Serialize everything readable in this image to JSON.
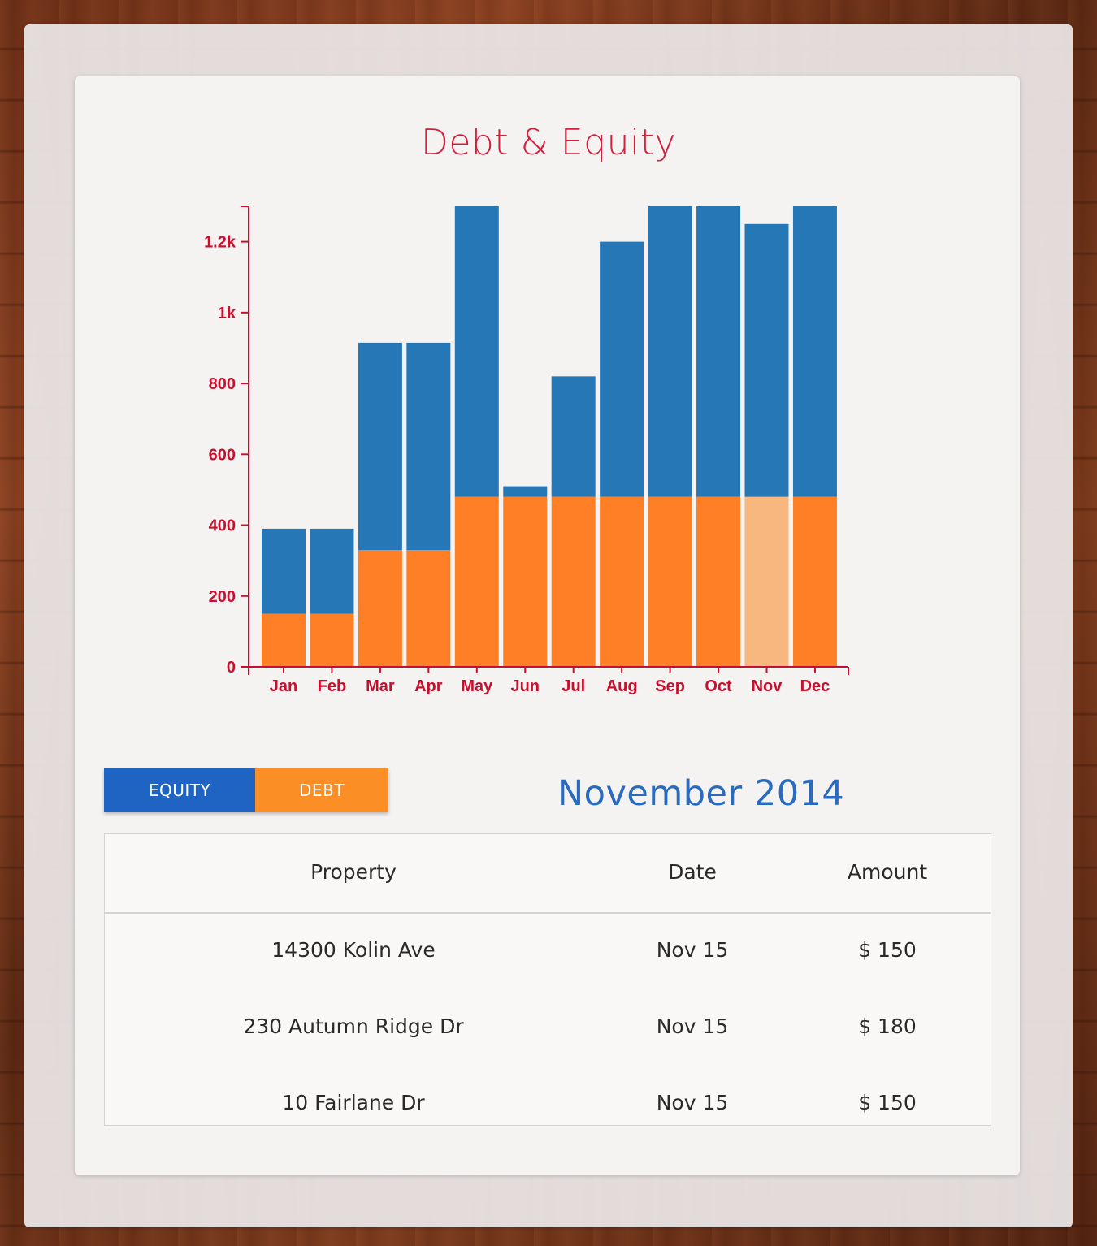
{
  "chart_data": {
    "type": "bar",
    "stacked": true,
    "title": "Debt & Equity",
    "categories": [
      "Jan",
      "Feb",
      "Mar",
      "Apr",
      "May",
      "Jun",
      "Jul",
      "Aug",
      "Sep",
      "Oct",
      "Nov",
      "Dec"
    ],
    "series": [
      {
        "name": "Debt",
        "color": "#ff7f27",
        "values": [
          150,
          150,
          330,
          330,
          480,
          480,
          480,
          480,
          480,
          480,
          480,
          480
        ]
      },
      {
        "name": "Equity",
        "color": "#2677b6",
        "values": [
          240,
          240,
          585,
          585,
          820,
          30,
          340,
          720,
          820,
          820,
          770,
          820
        ]
      }
    ],
    "highlighted_category": "Nov",
    "highlight_color": "#f7b77f",
    "yticks": [
      {
        "value": 0,
        "label": "0"
      },
      {
        "value": 200,
        "label": "200"
      },
      {
        "value": 400,
        "label": "400"
      },
      {
        "value": 600,
        "label": "600"
      },
      {
        "value": 800,
        "label": "800"
      },
      {
        "value": 1000,
        "label": "1k"
      },
      {
        "value": 1200,
        "label": "1.2k"
      }
    ],
    "ylim": [
      0,
      1300
    ],
    "axis_color": "#c8102e",
    "grid": false
  },
  "toggle": {
    "equity_label": "EQUITY",
    "debt_label": "DEBT",
    "equity_color": "#1f64c2",
    "debt_color": "#fb8e24"
  },
  "period": {
    "title": "November 2014"
  },
  "table": {
    "headers": {
      "property": "Property",
      "date": "Date",
      "amount": "Amount"
    },
    "rows": [
      {
        "property": "14300 Kolin Ave",
        "date": "Nov 15",
        "amount": "$ 150"
      },
      {
        "property": "230 Autumn Ridge Dr",
        "date": "Nov 15",
        "amount": "$ 180"
      },
      {
        "property": "10 Fairlane Dr",
        "date": "Nov 15",
        "amount": "$ 150"
      }
    ]
  }
}
